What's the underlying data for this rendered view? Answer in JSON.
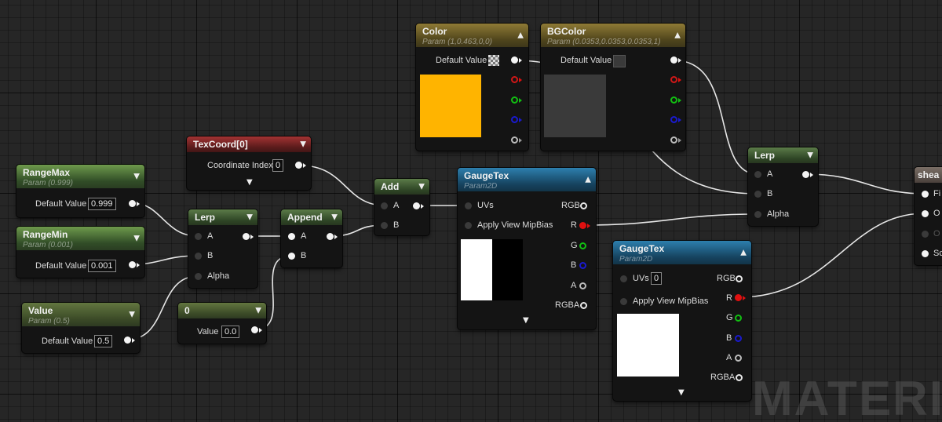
{
  "watermark": "MATERIAL",
  "accent_colors": {
    "float_header": "#6e9a4c",
    "vector_header": "#8e7a35",
    "texture_header": "#2d7fae",
    "texcoord_header": "#a33333",
    "color_swatch": "#ffb400",
    "bg_swatch": "#3a3a3a"
  },
  "icons": {
    "collapse": "chevron-up-icon",
    "expand": "chevron-down-icon",
    "preview": "checker-icon"
  },
  "nodes": {
    "range_max": {
      "title": "RangeMax",
      "subtitle": "Param (0.999)",
      "label": "Default Value",
      "value": "0.999"
    },
    "range_min": {
      "title": "RangeMin",
      "subtitle": "Param (0.001)",
      "label": "Default Value",
      "value": "0.001"
    },
    "value": {
      "title": "Value",
      "subtitle": "Param (0.5)",
      "label": "Default Value",
      "value": "0.5"
    },
    "texcoord": {
      "title": "TexCoord[0]",
      "label": "Coordinate Index",
      "value": "0"
    },
    "lerp1": {
      "title": "Lerp",
      "pin_a": "A",
      "pin_b": "B",
      "pin_alpha": "Alpha"
    },
    "constant": {
      "title": "0",
      "label": "Value",
      "value": "0.0"
    },
    "append": {
      "title": "Append",
      "pin_a": "A",
      "pin_b": "B"
    },
    "add": {
      "title": "Add",
      "pin_a": "A",
      "pin_b": "B"
    },
    "color": {
      "title": "Color",
      "subtitle": "Param (1,0.463,0,0)",
      "label": "Default Value",
      "swatch": "#ffb400"
    },
    "bgcolor": {
      "title": "BGColor",
      "subtitle": "Param (0.0353,0.0353,0.0353,1)",
      "label": "Default Value",
      "swatch": "#3a3a3a"
    },
    "gaugetex1": {
      "title": "GaugeTex",
      "subtitle": "Param2D",
      "uvs": "UVs",
      "mip": "Apply View MipBias",
      "rgb": "RGB",
      "r": "R",
      "g": "G",
      "b": "B",
      "a": "A",
      "rgba": "RGBA"
    },
    "gaugetex2": {
      "title": "GaugeTex",
      "subtitle": "Param2D",
      "uvs": "UVs",
      "uvs_value": "0",
      "mip": "Apply View MipBias",
      "rgb": "RGB",
      "r": "R",
      "g": "G",
      "b": "B",
      "a": "A",
      "rgba": "RGBA"
    },
    "lerp2": {
      "title": "Lerp",
      "pin_a": "A",
      "pin_b": "B",
      "pin_alpha": "Alpha"
    },
    "shear": {
      "title": "shea",
      "pin_1": "Fi",
      "pin_2": "O",
      "pin_3": "O",
      "pin_4": "Sc"
    }
  }
}
